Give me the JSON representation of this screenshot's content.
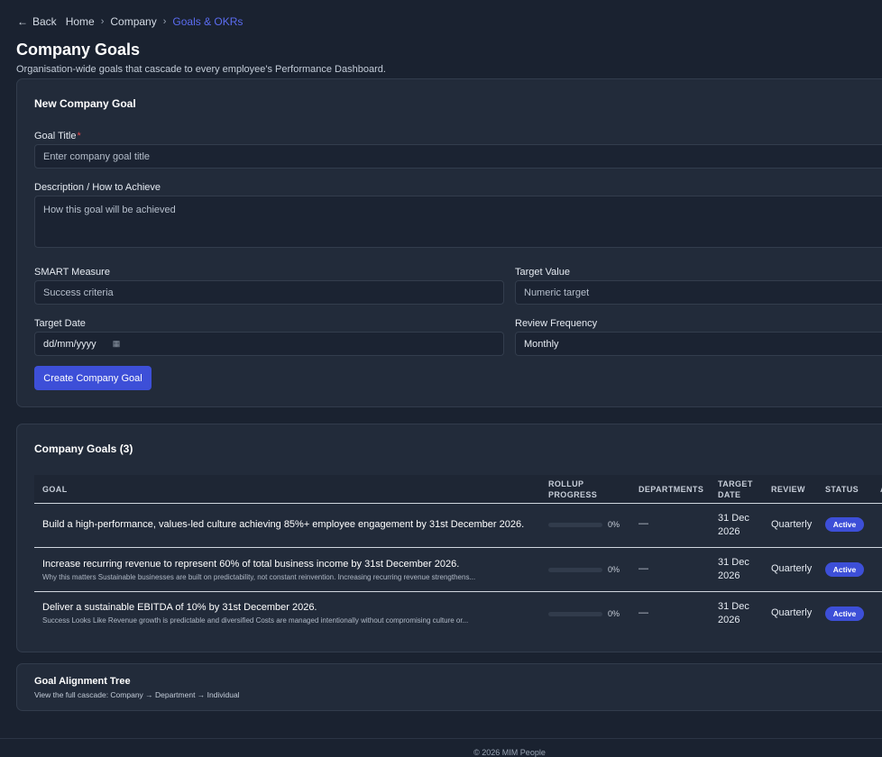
{
  "breadcrumb": {
    "back_label": "Back",
    "items": [
      "Home",
      "Company"
    ],
    "current": "Goals & OKRs"
  },
  "page": {
    "title": "Company Goals",
    "subtitle": "Organisation-wide goals that cascade to every employee's Performance Dashboard."
  },
  "new_goal_form": {
    "title": "New Company Goal",
    "goal_title_label": "Goal Title",
    "required_marker": "*",
    "goal_title_placeholder": "Enter company goal title",
    "description_label": "Description / How to Achieve",
    "description_placeholder": "How this goal will be achieved",
    "smart_measure_label": "SMART Measure",
    "smart_measure_placeholder": "Success criteria",
    "target_value_label": "Target Value",
    "target_value_placeholder": "Numeric target",
    "target_date_label": "Target Date",
    "target_date_placeholder": "dd/mm/yyyy",
    "review_frequency_label": "Review Frequency",
    "review_frequency_value": "Monthly",
    "create_button": "Create Company Goal"
  },
  "goals_table": {
    "title": "Company Goals (3)",
    "columns": {
      "goal": "Goal",
      "rollup_line1": "Rollup",
      "rollup_line2": "Progress",
      "departments": "Departments",
      "target_line1": "Target",
      "target_line2": "Date",
      "review": "Review",
      "status": "Status",
      "actions_partial": "A"
    },
    "rows": [
      {
        "title": "Build a high-performance, values-led culture achieving 85%+ employee engagement by 31st December 2026.",
        "description": "",
        "progress": 0,
        "progress_label": "0%",
        "departments": "—",
        "target_date_line1": "31 Dec",
        "target_date_line2": "2026",
        "review": "Quarterly",
        "status": "Active"
      },
      {
        "title": "Increase recurring revenue to represent 60% of total business income by 31st December 2026.",
        "description": "Why this matters Sustainable businesses are built on predictability, not constant reinvention. Increasing recurring revenue strengthens...",
        "progress": 0,
        "progress_label": "0%",
        "departments": "—",
        "target_date_line1": "31 Dec",
        "target_date_line2": "2026",
        "review": "Quarterly",
        "status": "Active"
      },
      {
        "title": "Deliver a sustainable EBITDA of 10% by 31st December 2026.",
        "description": "Success Looks Like Revenue growth is predictable and diversified Costs are managed intentionally without compromising culture or...",
        "progress": 0,
        "progress_label": "0%",
        "departments": "—",
        "target_date_line1": "31 Dec",
        "target_date_line2": "2026",
        "review": "Quarterly",
        "status": "Active"
      }
    ]
  },
  "alignment_tree": {
    "title": "Goal Alignment Tree",
    "subtitle": "View the full cascade: Company → Department → Individual"
  },
  "footer": {
    "text": "© 2026 MIM People"
  },
  "colors": {
    "background": "#1a2230",
    "card": "#222b3a",
    "accent": "#3d4fd8",
    "breadcrumb_current": "#5b6cf0",
    "required": "#e5484d"
  }
}
